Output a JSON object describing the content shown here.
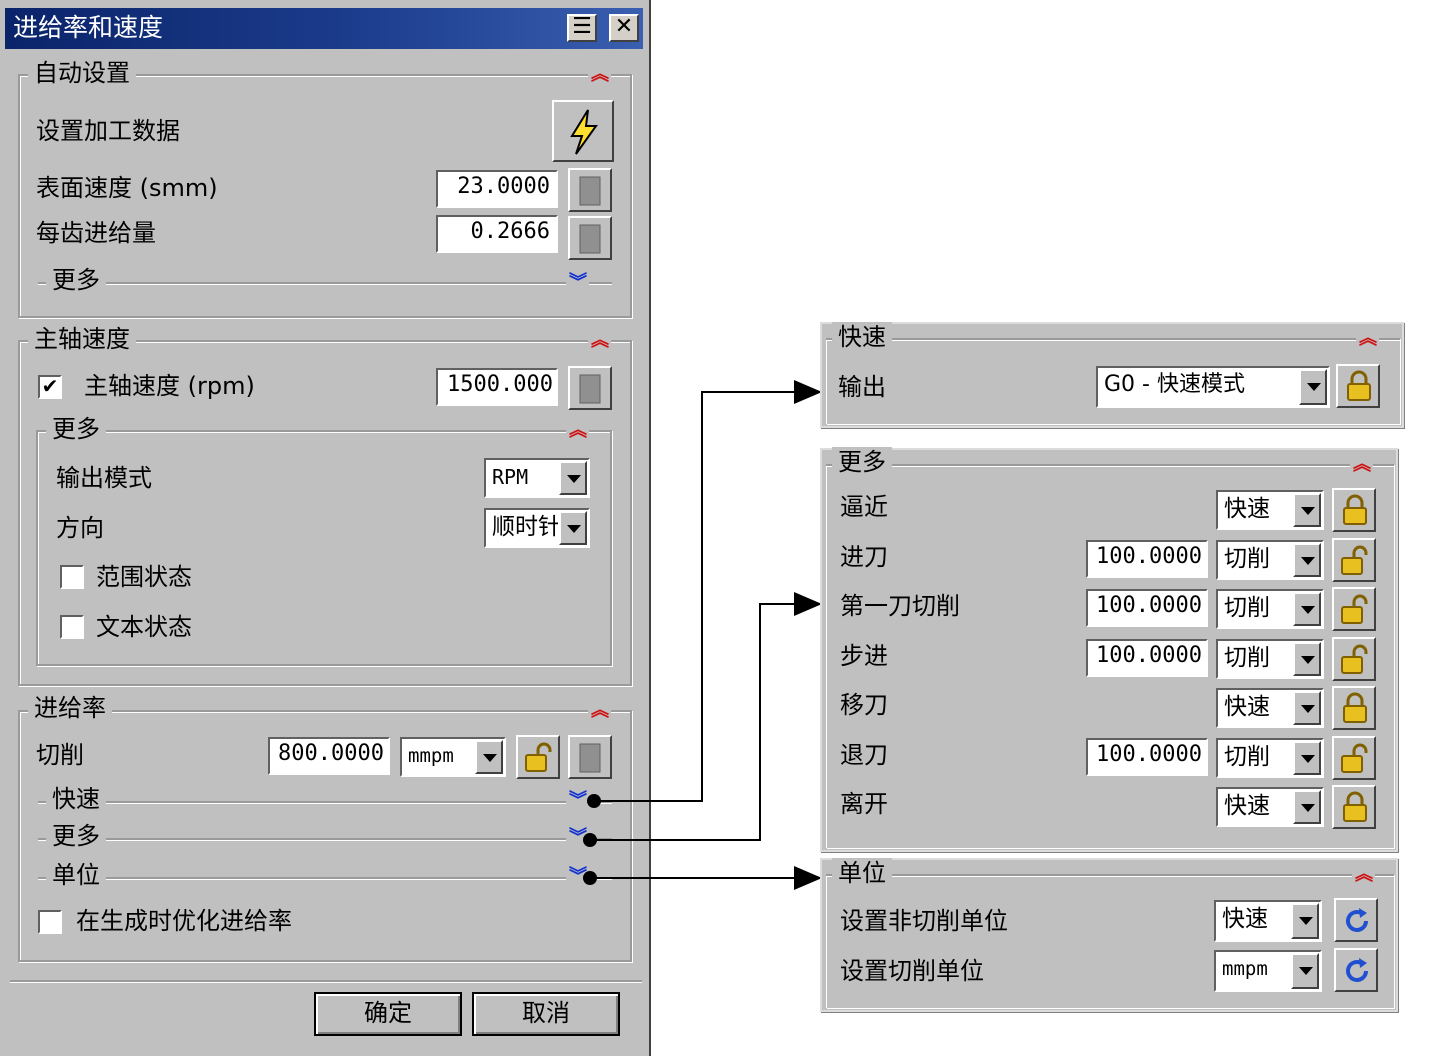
{
  "dialog": {
    "title": "进给率和速度",
    "auto": {
      "header": "自动设置",
      "set_data": "设置加工数据",
      "surface_speed_label": "表面速度 (smm)",
      "surface_speed_value": "23.0000",
      "feed_per_tooth_label": "每齿进给量",
      "feed_per_tooth_value": "0.2666",
      "more": "更多"
    },
    "spindle": {
      "header": "主轴速度",
      "speed_label": "主轴速度 (rpm)",
      "speed_checked": "✔",
      "speed_value": "1500.000",
      "more": "更多",
      "output_mode_label": "输出模式",
      "output_mode_value": "RPM",
      "direction_label": "方向",
      "direction_value": "顺时针",
      "range_label": "范围状态",
      "text_label": "文本状态"
    },
    "feed": {
      "header": "进给率",
      "cut_label": "切削",
      "cut_value": "800.0000",
      "cut_unit": "mmpm",
      "rapid": "快速",
      "more": "更多",
      "units": "单位",
      "optimize_label": "在生成时优化进给率"
    },
    "ok": "确定",
    "cancel": "取消"
  },
  "rapid_panel": {
    "header": "快速",
    "output_label": "输出",
    "output_value": "G0 - 快速模式"
  },
  "more_panel": {
    "header": "更多",
    "rows": [
      {
        "label": "逼近",
        "value": "",
        "mode": "快速"
      },
      {
        "label": "进刀",
        "value": "100.0000",
        "mode": "切削"
      },
      {
        "label": "第一刀切削",
        "value": "100.0000",
        "mode": "切削"
      },
      {
        "label": "步进",
        "value": "100.0000",
        "mode": "切削"
      },
      {
        "label": "移刀",
        "value": "",
        "mode": "快速"
      },
      {
        "label": "退刀",
        "value": "100.0000",
        "mode": "切削"
      },
      {
        "label": "离开",
        "value": "",
        "mode": "快速"
      }
    ]
  },
  "units_panel": {
    "header": "单位",
    "noncut_label": "设置非切削单位",
    "noncut_value": "快速",
    "cut_label": "设置切削单位",
    "cut_value": "mmpm"
  },
  "colors": {
    "title_bar": "#0a246a",
    "face": "#c0c0c0",
    "expand": "#d01010",
    "collapse": "#1030d0",
    "lock": "#e8c020"
  }
}
